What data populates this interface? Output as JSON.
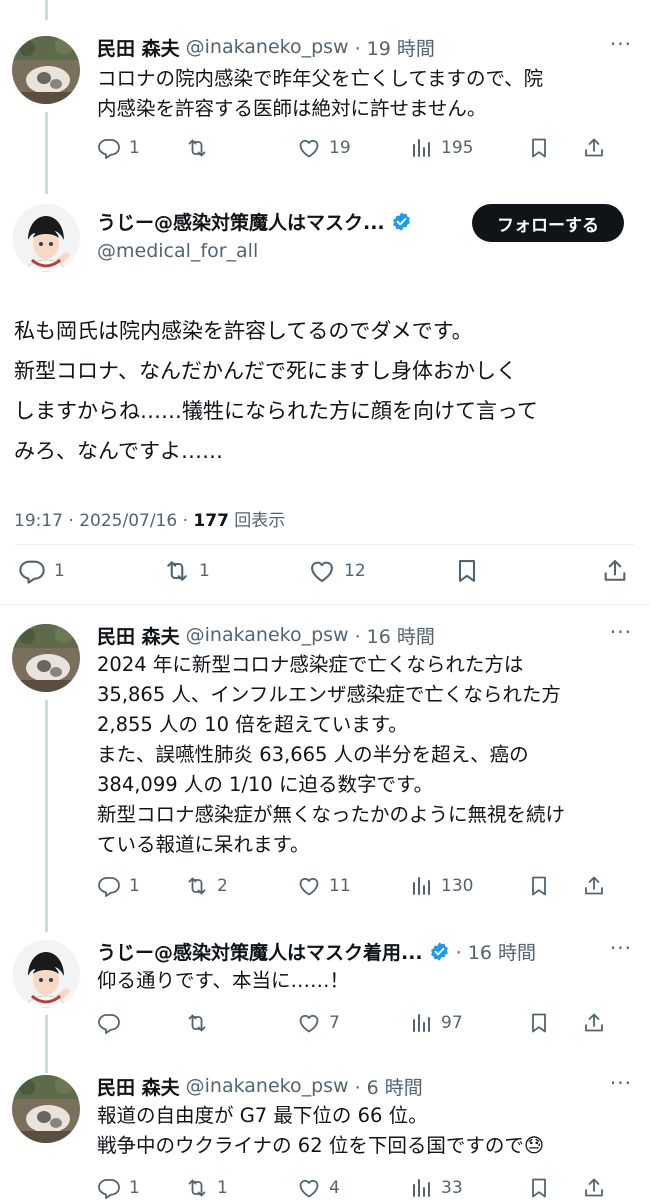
{
  "colors": {
    "text": "#0f1419",
    "muted": "#536471",
    "verified": "#1d9bf0",
    "line": "#cfd9de"
  },
  "tweet1": {
    "name": "民田 森夫",
    "handle": "@inakaneko_psw",
    "time": "· 19 時間",
    "text": "コロナの院内感染で昨年父を亡くしてますので、院\n内感染を許容する医師は絶対に許せません。",
    "replies": "1",
    "retweets": "",
    "likes": "19",
    "views": "195"
  },
  "main": {
    "name": "うじー@感染対策魔人はマスク...",
    "handle": "@medical_for_all",
    "follow_label": "フォローする",
    "text": "私も岡氏は院内感染を許容してるのでダメです。\n新型コロナ、なんだかんだで死にますし身体おかしく\nしますからね……犠牲になられた方に顔を向けて言って\nみろ、なんですよ……",
    "timestamp": "19:17 · 2025/07/16 · ",
    "views_count": "177",
    "views_label": " 回表示",
    "replies": "1",
    "retweets": "1",
    "likes": "12"
  },
  "tweet3": {
    "name": "民田 森夫",
    "handle": "@inakaneko_psw",
    "time": "· 16 時間",
    "text": "2024 年に新型コロナ感染症で亡くなられた方は\n35,865 人、インフルエンザ感染症で亡くなられた方\n2,855 人の 10 倍を超えています。\nまた、誤嚥性肺炎 63,665 人の半分を超え、癌の\n384,099 人の 1/10 に迫る数字です。\n新型コロナ感染症が無くなったかのように無視を続け\nている報道に呆れます。",
    "replies": "1",
    "retweets": "2",
    "likes": "11",
    "views": "130"
  },
  "tweet4": {
    "name": "うじー@感染対策魔人はマスク着用...",
    "time": "· 16 時間",
    "text": "仰る通りです、本当に……！",
    "replies": "",
    "retweets": "",
    "likes": "7",
    "views": "97"
  },
  "tweet5": {
    "name": "民田 森夫",
    "handle": "@inakaneko_psw",
    "time": "· 6 時間",
    "text": "報道の自由度が G7 最下位の 66 位。\n戦争中のウクライナの 62 位を下回る国ですので",
    "emoji": "😓",
    "replies": "1",
    "retweets": "1",
    "likes": "4",
    "views": "33"
  }
}
